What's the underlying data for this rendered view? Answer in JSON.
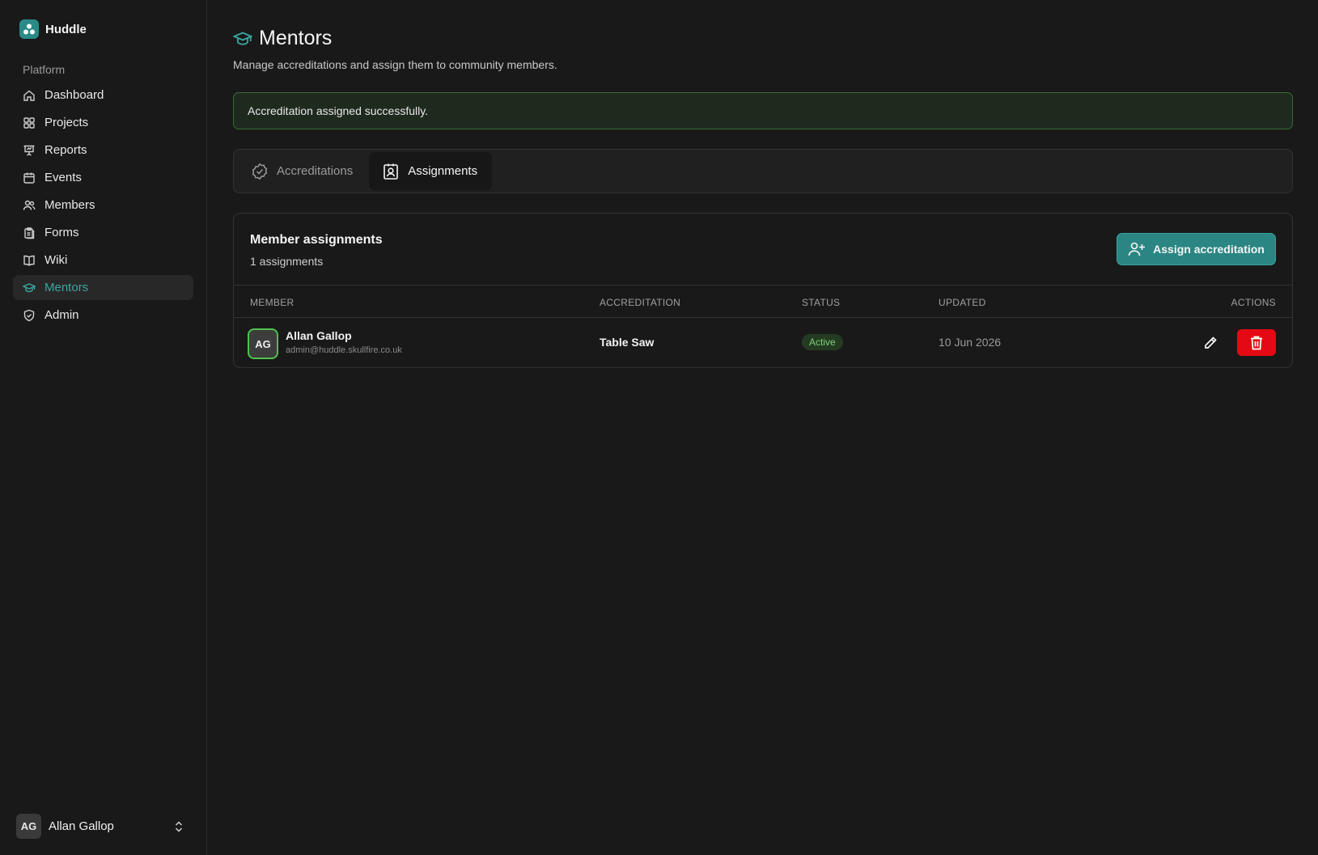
{
  "app": {
    "name": "Huddle"
  },
  "sidebar": {
    "group_label": "Platform",
    "items": [
      {
        "label": "Dashboard",
        "icon": "home-icon",
        "active": false
      },
      {
        "label": "Projects",
        "icon": "grid-icon",
        "active": false
      },
      {
        "label": "Reports",
        "icon": "presentation-icon",
        "active": false
      },
      {
        "label": "Events",
        "icon": "calendar-icon",
        "active": false
      },
      {
        "label": "Members",
        "icon": "users-icon",
        "active": false
      },
      {
        "label": "Forms",
        "icon": "clipboard-icon",
        "active": false
      },
      {
        "label": "Wiki",
        "icon": "book-icon",
        "active": false
      },
      {
        "label": "Mentors",
        "icon": "graduation-cap-icon",
        "active": true
      },
      {
        "label": "Admin",
        "icon": "shield-icon",
        "active": false
      }
    ],
    "user": {
      "initials": "AG",
      "name": "Allan Gallop"
    }
  },
  "page": {
    "title": "Mentors",
    "subtitle": "Manage accreditations and assign them to community members."
  },
  "alert": {
    "message": "Accreditation assigned successfully."
  },
  "tabs": [
    {
      "label": "Accreditations",
      "active": false
    },
    {
      "label": "Assignments",
      "active": true
    }
  ],
  "card": {
    "title": "Member assignments",
    "count": "1 assignments",
    "assign_button": "Assign accreditation",
    "columns": [
      "MEMBER",
      "ACCREDITATION",
      "STATUS",
      "UPDATED",
      "ACTIONS"
    ],
    "rows": [
      {
        "initials": "AG",
        "name": "Allan Gallop",
        "email": "admin@huddle.skullfire.co.uk",
        "accreditation": "Table Saw",
        "status": "Active",
        "updated": "10 Jun 2026"
      }
    ]
  },
  "colors": {
    "accent": "#2b8683",
    "active_nav": "#3aa7a2",
    "success_border": "#3a6a37",
    "status_active": "#7fd079",
    "danger": "#e50913"
  }
}
